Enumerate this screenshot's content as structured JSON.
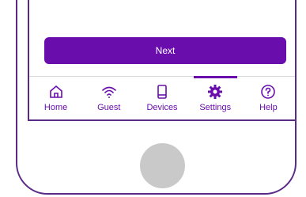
{
  "action": {
    "next_label": "Next"
  },
  "tabs": [
    {
      "label": "Home",
      "icon": "home-icon",
      "active": false
    },
    {
      "label": "Guest",
      "icon": "wifi-icon",
      "active": false
    },
    {
      "label": "Devices",
      "icon": "device-icon",
      "active": false
    },
    {
      "label": "Settings",
      "icon": "gear-icon",
      "active": true
    },
    {
      "label": "Help",
      "icon": "help-icon",
      "active": false
    }
  ],
  "colors": {
    "accent": "#6a0dad",
    "frame": "#5b2a86",
    "home_button": "#c9c9c9"
  }
}
